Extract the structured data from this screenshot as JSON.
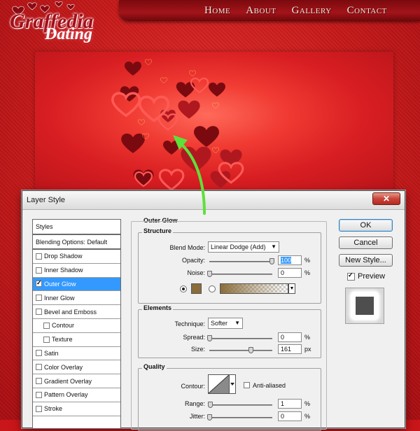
{
  "site": {
    "nav": [
      "Home",
      "About",
      "Gallery",
      "Contact"
    ],
    "logo_line1": "Graffedia",
    "logo_line2": "Dating"
  },
  "dialog": {
    "title": "Layer Style",
    "close_label": "✕",
    "styles_header": "Styles",
    "blending_options": "Blending Options: Default",
    "style_items": [
      {
        "label": "Drop Shadow",
        "checked": false
      },
      {
        "label": "Inner Shadow",
        "checked": false
      },
      {
        "label": "Outer Glow",
        "checked": true
      },
      {
        "label": "Inner Glow",
        "checked": false
      },
      {
        "label": "Bevel and Emboss",
        "checked": false
      },
      {
        "label": "Contour",
        "checked": false
      },
      {
        "label": "Texture",
        "checked": false
      },
      {
        "label": "Satin",
        "checked": false
      },
      {
        "label": "Color Overlay",
        "checked": false
      },
      {
        "label": "Gradient Overlay",
        "checked": false
      },
      {
        "label": "Pattern Overlay",
        "checked": false
      },
      {
        "label": "Stroke",
        "checked": false
      }
    ],
    "section_title": "Outer Glow",
    "structure": {
      "title": "Structure",
      "blend_mode_label": "Blend Mode:",
      "blend_mode_value": "Linear Dodge (Add)",
      "opacity_label": "Opacity:",
      "opacity_value": "100",
      "opacity_unit": "%",
      "noise_label": "Noise:",
      "noise_value": "0",
      "noise_unit": "%",
      "glow_color": "#8a6d3b",
      "opacity_level": 1.0,
      "noise_level": 0.0
    },
    "elements": {
      "title": "Elements",
      "technique_label": "Technique:",
      "technique_value": "Softer",
      "spread_label": "Spread:",
      "spread_value": "0",
      "spread_unit": "%",
      "size_label": "Size:",
      "size_value": "161",
      "size_unit": "px"
    },
    "quality": {
      "title": "Quality",
      "contour_label": "Contour:",
      "antialiased_label": "Anti-aliased",
      "range_label": "Range:",
      "range_value": "1",
      "range_unit": "%",
      "jitter_label": "Jitter:",
      "jitter_value": "0",
      "jitter_unit": "%"
    },
    "buttons": {
      "ok": "OK",
      "cancel": "Cancel",
      "new_style": "New Style...",
      "preview_label": "Preview",
      "preview_checked": true
    }
  },
  "colors": {
    "selection_blue": "#3399ff",
    "arrow_green": "#5fe03a",
    "banner_red": "#e8322e"
  }
}
